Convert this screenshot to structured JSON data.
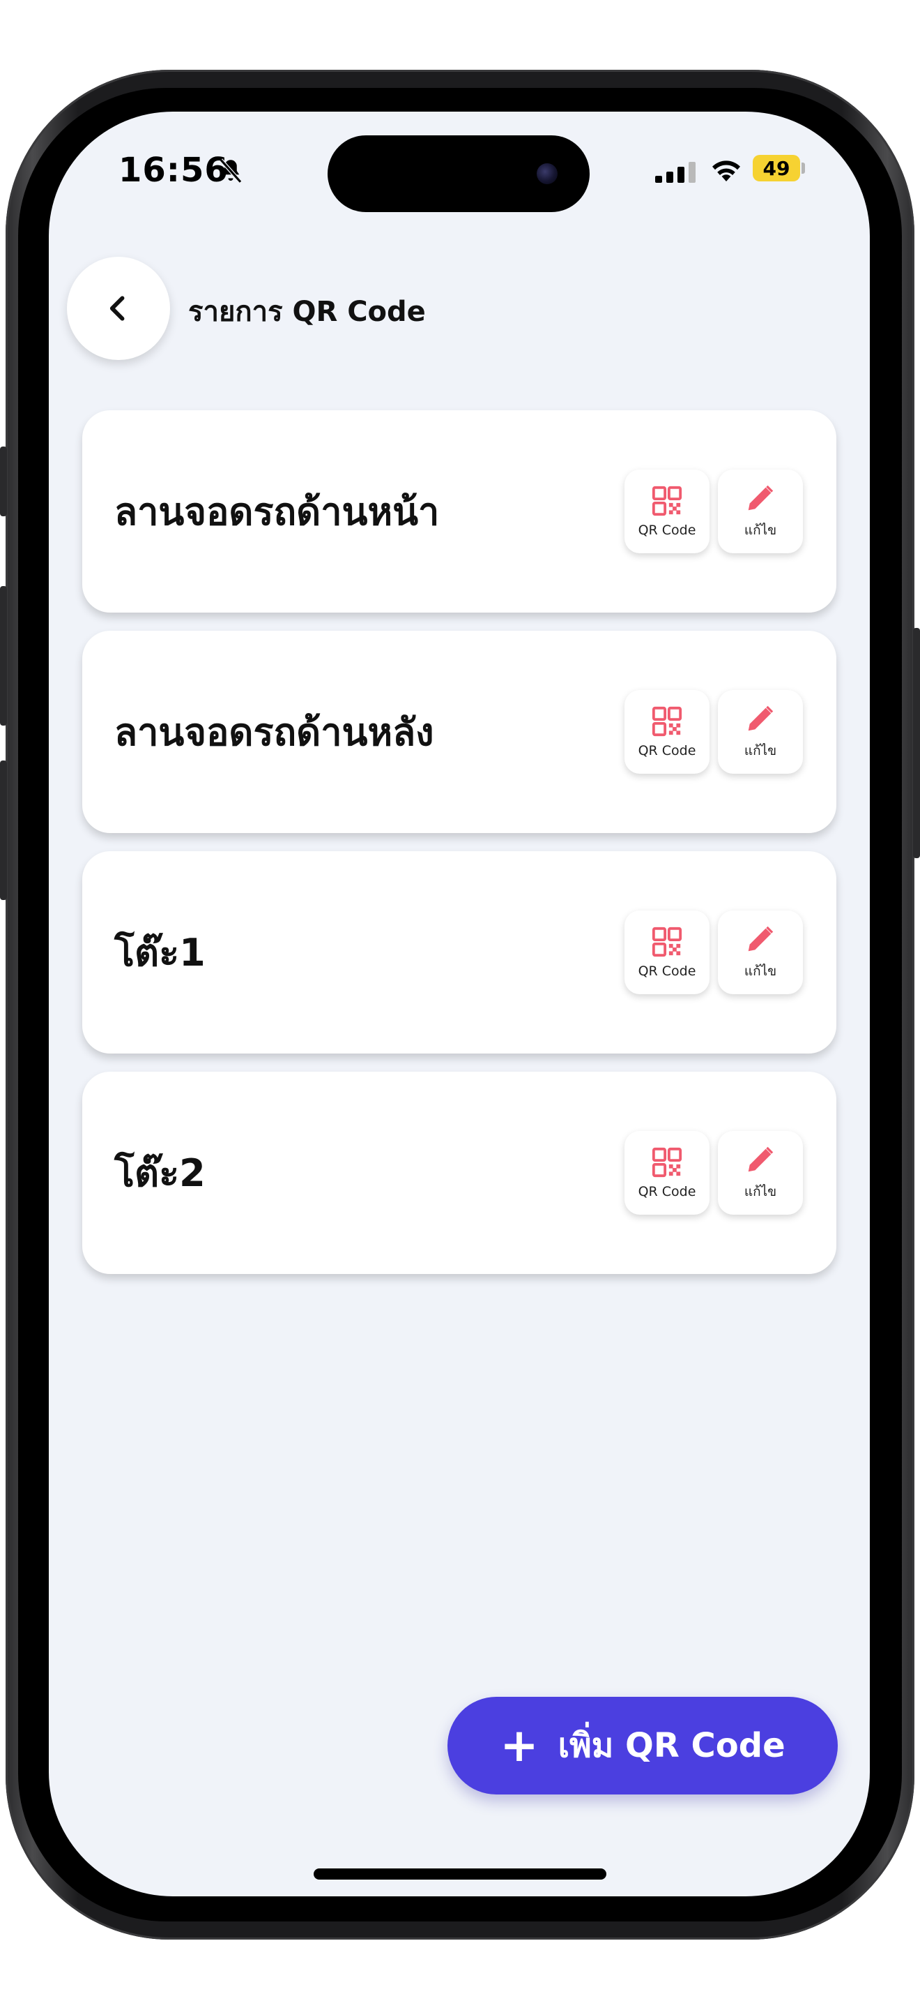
{
  "status_bar": {
    "time": "16:56",
    "battery": "49"
  },
  "header": {
    "back_icon": "chevron-left-icon",
    "title": "รายการ QR Code"
  },
  "items": [
    {
      "name": "ลานจอดรถด้านหน้า",
      "qr_label": "QR Code",
      "edit_label": "แก้ไข"
    },
    {
      "name": "ลานจอดรถด้านหลัง",
      "qr_label": "QR Code",
      "edit_label": "แก้ไข"
    },
    {
      "name": "โต๊ะ1",
      "qr_label": "QR Code",
      "edit_label": "แก้ไข"
    },
    {
      "name": "โต๊ะ2",
      "qr_label": "QR Code",
      "edit_label": "แก้ไข"
    }
  ],
  "fab": {
    "icon": "+",
    "label": "เพิ่ม QR Code"
  },
  "colors": {
    "accent": "#4b3fe0",
    "icon_red": "#f05a6e",
    "background": "#f0f3f9",
    "battery": "#f6d232"
  }
}
